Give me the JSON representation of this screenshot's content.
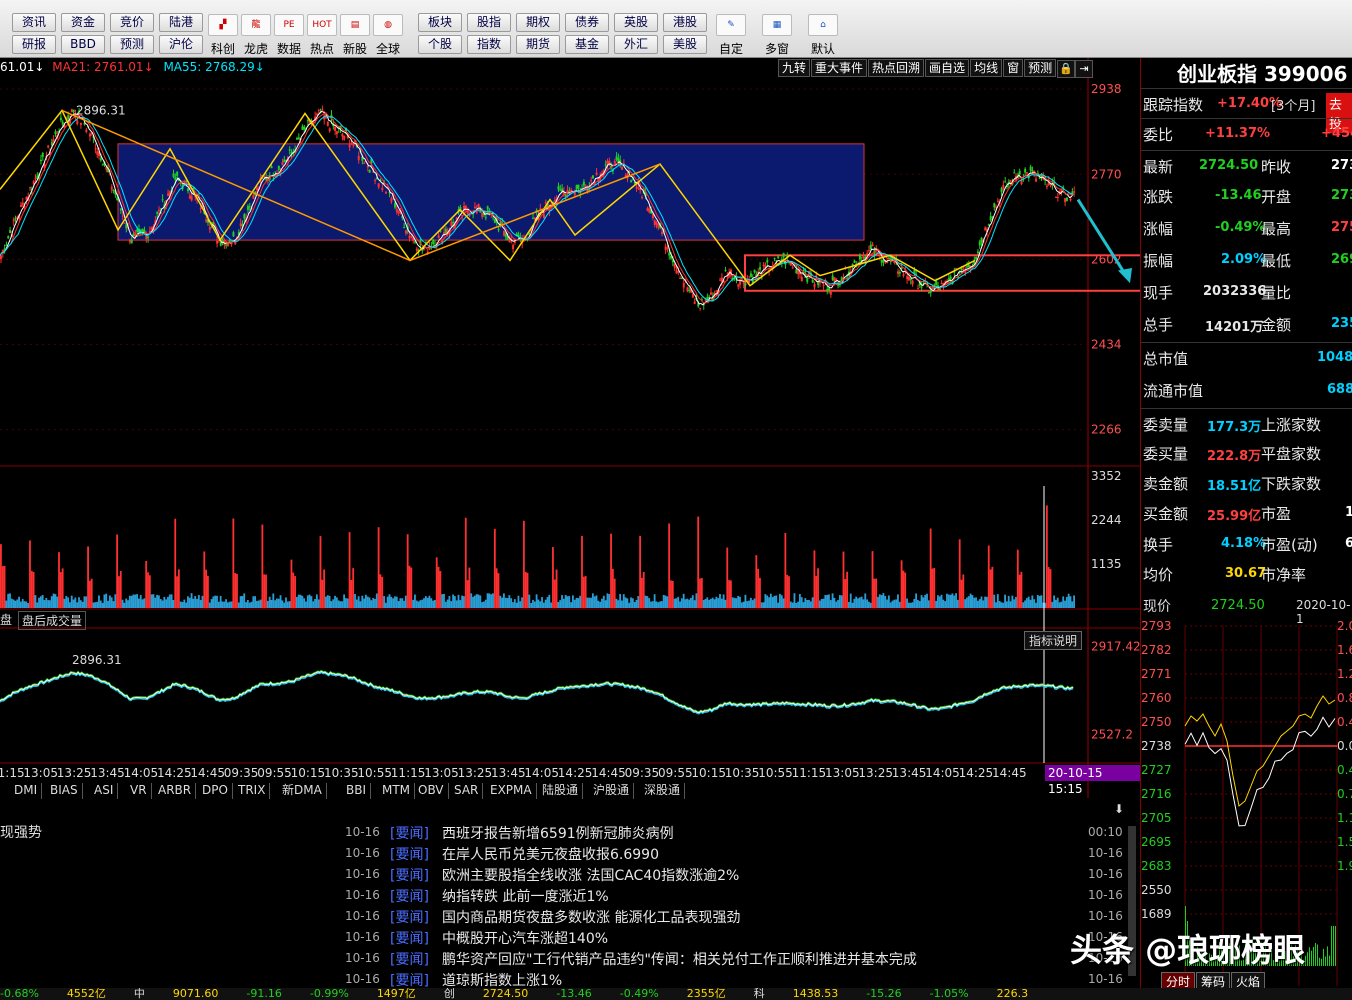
{
  "toolbar": {
    "row1": [
      "资讯",
      "资金",
      "竞价",
      "陆港"
    ],
    "row2": [
      "研报",
      "BBD",
      "预测",
      "沪伦"
    ],
    "icons": [
      {
        "name": "star-board-icon",
        "label": "科创",
        "glyph": "▞"
      },
      {
        "name": "dragon-tiger-icon",
        "label": "龙虎",
        "glyph": "龍"
      },
      {
        "name": "data-icon",
        "label": "数据",
        "glyph": "PE"
      },
      {
        "name": "hot-icon",
        "label": "热点",
        "glyph": "HOT"
      },
      {
        "name": "new-stock-icon",
        "label": "新股",
        "glyph": "▤"
      },
      {
        "name": "globe-icon",
        "label": "全球",
        "glyph": "◍"
      }
    ],
    "row1b": [
      "板块",
      "股指",
      "期权",
      "债券",
      "英股",
      "港股"
    ],
    "row2b": [
      "个股",
      "指数",
      "期货",
      "基金",
      "外汇",
      "美股"
    ],
    "icons2": [
      {
        "name": "custom-icon",
        "label": "自定",
        "glyph": "✎"
      },
      {
        "name": "multi-window-icon",
        "label": "多窗",
        "glyph": "▦"
      },
      {
        "name": "home-icon",
        "label": "默认",
        "glyph": "⌂"
      }
    ]
  },
  "ma_bar": {
    "ma_a": "61.01↓",
    "ma21": "MA21: 2761.01↓",
    "ma55": "MA55: 2768.29↓"
  },
  "chart_tools": [
    "九转",
    "重大事件",
    "热点回溯",
    "画自选",
    "均线",
    "窗",
    "预测"
  ],
  "stock_title": "创业板指 399006",
  "quote": {
    "track_label": "跟踪指数",
    "track_val": "+17.40%",
    "track_period": "[3个月]",
    "track_btn": "去投",
    "weibi_label": "委比",
    "weibi_val": "+11.37%",
    "weibi_val2": "+454",
    "latest_label": "最新",
    "latest_val": "2724.50",
    "prev_label": "昨收",
    "prev_val": "273",
    "change_label": "涨跌",
    "change_val": "-13.46",
    "open_label": "开盘",
    "open_val": "273",
    "pct_label": "涨幅",
    "pct_val": "-0.49%",
    "high_label": "最高",
    "high_val": "275",
    "amp_label": "振幅",
    "amp_val": "2.09%",
    "low_label": "最低",
    "low_val": "269",
    "cur_label": "现手",
    "cur_val": "2032336",
    "vr_label": "量比",
    "tot_label": "总手",
    "tot_val": "14201万",
    "amt_label": "金额",
    "amt_val": "235",
    "mktcap_label": "总市值",
    "mktcap_val": "10487",
    "float_label": "流通市值",
    "float_val": "6888",
    "sellvol_label": "委卖量",
    "sellvol_val": "177.3万",
    "up_label": "上涨家数",
    "buyvol_label": "委买量",
    "buyvol_val": "222.8万",
    "flat_label": "平盘家数",
    "sellamt_label": "卖金额",
    "sellamt_val": "18.51亿",
    "down_label": "下跌家数",
    "buyamt_label": "买金额",
    "buyamt_val": "25.99亿",
    "pe_label": "市盈",
    "pe_val": "1",
    "turn_label": "换手",
    "turn_val": "4.18%",
    "ped_label": "市盈(动)",
    "ped_val": "6",
    "avg_label": "均价",
    "avg_val": "30.67",
    "pb_label": "市净率"
  },
  "mini": {
    "price_label": "现价",
    "price_val": "2724.50",
    "date": "2020-10-1"
  },
  "panel_labels": {
    "after_hours": "盘后成交量",
    "left_stub": "盘",
    "indicator_help": "指标说明",
    "cursor_date": "20-10-15 15:15",
    "news_heading": "现强势"
  },
  "indicator_tabs": [
    "DMI",
    "BIAS",
    "ASI",
    "VR",
    "ARBR",
    "DPO",
    "TRIX",
    "新DMA",
    "BBI",
    "MTM",
    "OBV",
    "SAR",
    "EXPMA",
    "陆股通",
    "沪股通",
    "深股通"
  ],
  "news": [
    {
      "date": "10-16",
      "tag": "[要闻]",
      "title": "西班牙报告新增6591例新冠肺炎病例",
      "time": "00:10"
    },
    {
      "date": "10-16",
      "tag": "[要闻]",
      "title": "在岸人民币兑美元夜盘收报6.6990",
      "time": "10-16"
    },
    {
      "date": "10-16",
      "tag": "[要闻]",
      "title": "欧洲主要股指全线收涨 法国CAC40指数涨逾2%",
      "time": "10-16"
    },
    {
      "date": "10-16",
      "tag": "[要闻]",
      "title": "纳指转跌  此前一度涨近1%",
      "time": "10-16"
    },
    {
      "date": "10-16",
      "tag": "[要闻]",
      "title": "国内商品期货夜盘多数收涨 能源化工品表现强劲",
      "time": "10-16"
    },
    {
      "date": "10-16",
      "tag": "[要闻]",
      "title": "中概股开心汽车涨超140%",
      "time": "10-16"
    },
    {
      "date": "10-16",
      "tag": "[要闻]",
      "title": "鹏华资产回应\"工行代销产品违约\"传闻：相关兑付工作正顺利推进并基本完成",
      "time": "10-16"
    },
    {
      "date": "10-16",
      "tag": "[要闻]",
      "title": "道琼斯指数上涨1%",
      "time": "10-16"
    }
  ],
  "mini_tabs": [
    "分时",
    "筹码",
    "火焰"
  ],
  "watermark": "头条 @琅琊榜眼",
  "bottom_bar": [
    "-0.68%",
    "4552亿",
    "中",
    "9071.60",
    "-91.16",
    "-0.99%",
    "1497亿",
    "创",
    "2724.50",
    "-13.46",
    "-0.49%",
    "2355亿",
    "科",
    "1438.53",
    "-15.26",
    "-1.05%",
    "226.3"
  ],
  "colors": {
    "up": "#ff3030",
    "down": "#20d020",
    "ma1": "#ffffff",
    "ma2": "#ffd700",
    "ma3": "#00e5ff",
    "zig": "#ff9900",
    "box": "#0b1a6e",
    "label": "#ff5050",
    "accent": "#1e90ff"
  },
  "chart_data": [
    {
      "type": "line",
      "description_role": "main candlestick price chart",
      "y_ticks": [
        2938,
        2770,
        2602,
        2434,
        2266
      ],
      "annotations": [
        "2896.31"
      ],
      "x_ticks": [
        "11:15",
        "13:05",
        "13:25",
        "13:45",
        "14:05",
        "14:25",
        "14:45",
        "09:35",
        "09:55",
        "10:15",
        "10:35",
        "10:55",
        "11:15",
        "13:05",
        "13:25",
        "13:45",
        "14:05",
        "14:25",
        "14:45",
        "09:35",
        "09:55",
        "10:15",
        "10:35",
        "10:55",
        "11:15",
        "13:05",
        "13:25",
        "13:45",
        "14:05",
        "14:25",
        "14:45"
      ],
      "series": [
        {
          "values": [
            2610,
            2680,
            2740,
            2800,
            2860,
            2896,
            2860,
            2800,
            2720,
            2640,
            2650,
            2700,
            2760,
            2740,
            2700,
            2640,
            2640,
            2700,
            2760,
            2780,
            2810,
            2860,
            2890,
            2860,
            2840,
            2800,
            2760,
            2720,
            2660,
            2620,
            2640,
            2670,
            2700,
            2700,
            2680,
            2640,
            2640,
            2690,
            2720,
            2740,
            2740,
            2770,
            2790,
            2780,
            2740,
            2690,
            2620,
            2560,
            2510,
            2530,
            2580,
            2560,
            2570,
            2590,
            2600,
            2580,
            2560,
            2550,
            2570,
            2600,
            2620,
            2600,
            2580,
            2560,
            2540,
            2550,
            2580,
            2600,
            2680,
            2740,
            2770,
            2770,
            2750,
            2730,
            2725
          ]
        }
      ]
    },
    {
      "type": "bar",
      "description_role": "volume",
      "y_ticks": [
        3352,
        2244,
        1135
      ]
    },
    {
      "type": "line",
      "description_role": "indicator",
      "y_ticks": [
        2917.42,
        2527.2
      ],
      "annotations": [
        "2896.31"
      ]
    },
    {
      "type": "line",
      "description_role": "intraday",
      "y_ticks_left": [
        2793,
        2782,
        2771,
        2760,
        2750,
        2738,
        2727,
        2716,
        2705,
        2695,
        2683,
        2550,
        1689
      ],
      "y_ticks_right": [
        "2.0",
        "1.6",
        "1.2",
        "0.8",
        "0.4",
        "0.0",
        "0.4",
        "0.7",
        "1.1",
        "1.5",
        "1.9"
      ]
    }
  ]
}
